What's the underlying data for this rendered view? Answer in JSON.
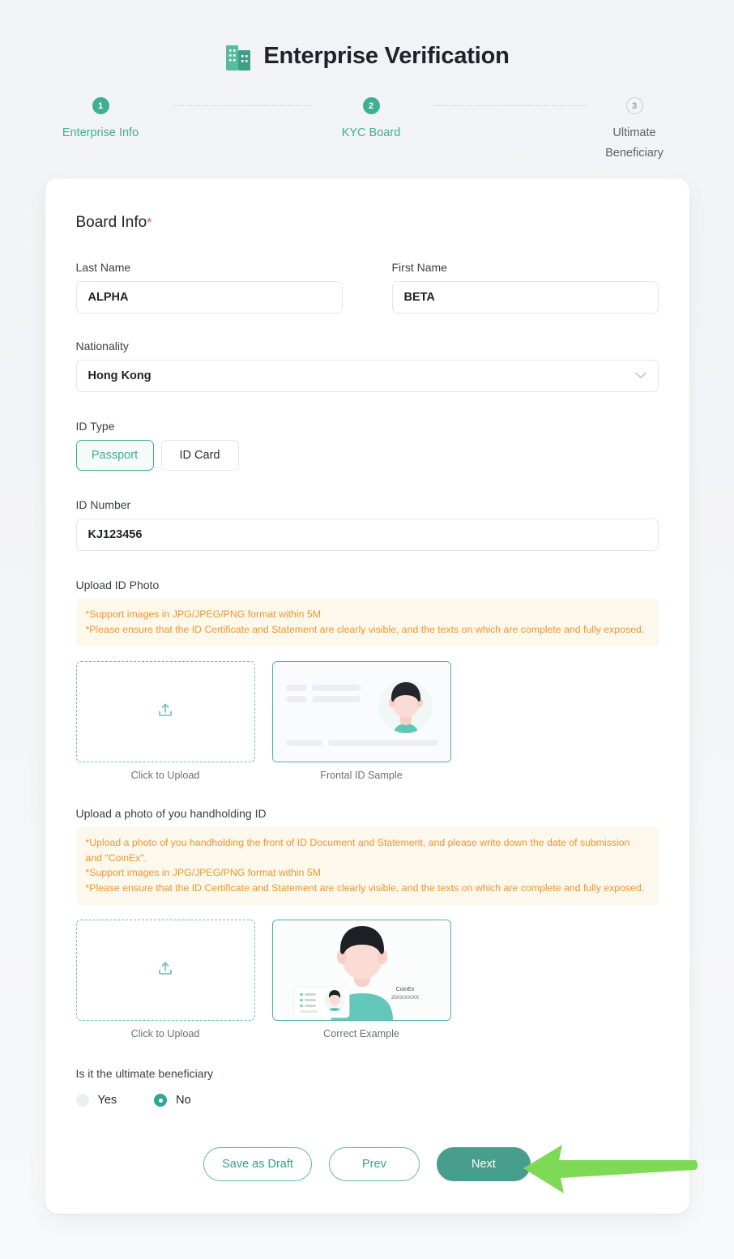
{
  "header": {
    "title": "Enterprise Verification",
    "icon": "building-icon"
  },
  "stepper": {
    "steps": [
      {
        "number": "1",
        "label": "Enterprise Info",
        "state": "done"
      },
      {
        "number": "2",
        "label": "KYC Board",
        "state": "done"
      },
      {
        "number": "3",
        "label": "Ultimate\nBeneficiary",
        "state": "todo"
      }
    ]
  },
  "form": {
    "section_title": "Board Info",
    "required_mark": "*",
    "last_name": {
      "label": "Last Name",
      "value": "ALPHA",
      "placeholder": "Last Name"
    },
    "first_name": {
      "label": "First Name",
      "value": "BETA",
      "placeholder": "First Name"
    },
    "nationality": {
      "label": "Nationality",
      "value": "Hong Kong",
      "icon": "chevron-down-icon"
    },
    "id_type": {
      "label": "ID Type",
      "options": [
        {
          "label": "Passport",
          "selected": true
        },
        {
          "label": "ID Card",
          "selected": false
        }
      ]
    },
    "id_number": {
      "label": "ID Number",
      "value": "KJ123456",
      "placeholder": "ID Number"
    },
    "upload_id_photo": {
      "label": "Upload ID Photo",
      "notice": [
        "*Support images in JPG/JPEG/PNG format within 5M",
        "*Please ensure that the ID Certificate and Statement are clearly visible, and the texts on which are complete and fully exposed."
      ],
      "dropzone_caption": "Click to Upload",
      "sample_caption": "Frontal ID Sample"
    },
    "upload_handholding": {
      "label": "Upload a photo of you handholding ID",
      "notice": [
        "*Upload a photo of you handholding the front of ID Document and Statement, and please write down the date of submission and \"CoinEx\".",
        "*Support images in JPG/JPEG/PNG format within 5M",
        "*Please ensure that the ID Certificate and Statement are clearly visible, and the texts on which are complete and fully exposed."
      ],
      "dropzone_caption": "Click to Upload",
      "sample_caption": "Correct Example",
      "sample_brand_text": "CoinEx",
      "sample_date_text": "20XX/XX/XX"
    },
    "ultimate_beneficiary": {
      "label": "Is it the ultimate beneficiary",
      "options": [
        {
          "label": "Yes",
          "selected": false
        },
        {
          "label": "No",
          "selected": true
        }
      ]
    }
  },
  "actions": {
    "save_draft": "Save as Draft",
    "prev": "Prev",
    "next": "Next"
  },
  "annotation": {
    "arrow": "left-pointing-arrow",
    "color": "#7ed957"
  },
  "colors": {
    "accent": "#3faf93",
    "primary_button": "#479e8b",
    "notice_text": "#f0962e",
    "notice_bg": "#fdf8ec",
    "required": "#e8513b",
    "page_bg": "#f3f4f6"
  }
}
